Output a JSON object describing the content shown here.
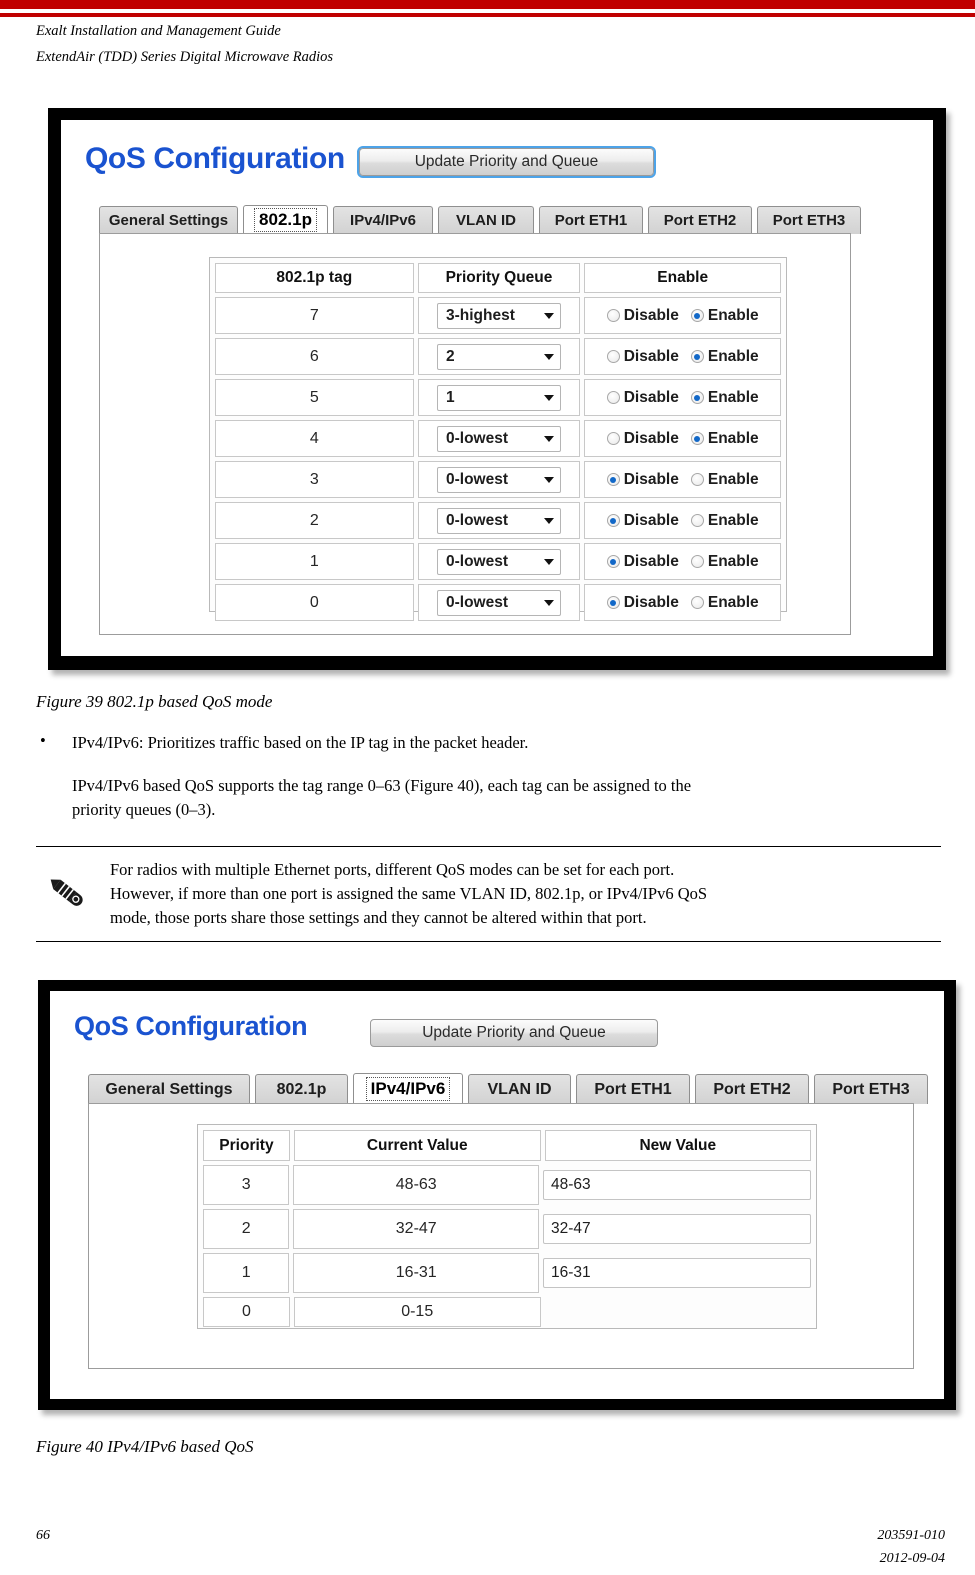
{
  "header": {
    "line1": "Exalt Installation and Management Guide",
    "line2": "ExtendAir (TDD) Series Digital Microwave Radios",
    "rule_color": "#c00000"
  },
  "figure39": {
    "caption": "Figure 39   802.1p based QoS mode",
    "screen": {
      "title": "QoS Configuration",
      "update_button": "Update Priority and Queue",
      "tabs": [
        {
          "label": "General Settings",
          "active": false
        },
        {
          "label": "802.1p",
          "active": true
        },
        {
          "label": "IPv4/IPv6",
          "active": false
        },
        {
          "label": "VLAN ID",
          "active": false
        },
        {
          "label": "Port ETH1",
          "active": false
        },
        {
          "label": "Port ETH2",
          "active": false
        },
        {
          "label": "Port ETH3",
          "active": false
        }
      ],
      "table": {
        "headers": [
          "802.1p tag",
          "Priority Queue",
          "Enable"
        ],
        "radio_labels": {
          "disable": "Disable",
          "enable": "Enable"
        },
        "rows": [
          {
            "tag": "7",
            "queue": "3-highest",
            "state": "enable"
          },
          {
            "tag": "6",
            "queue": "2",
            "state": "enable"
          },
          {
            "tag": "5",
            "queue": "1",
            "state": "enable"
          },
          {
            "tag": "4",
            "queue": "0-lowest",
            "state": "enable"
          },
          {
            "tag": "3",
            "queue": "0-lowest",
            "state": "disable"
          },
          {
            "tag": "2",
            "queue": "0-lowest",
            "state": "disable"
          },
          {
            "tag": "1",
            "queue": "0-lowest",
            "state": "disable"
          },
          {
            "tag": "0",
            "queue": "0-lowest",
            "state": "disable"
          }
        ]
      }
    }
  },
  "body": {
    "bullet_marker": "•",
    "bullet_text": "IPv4/IPv6: Prioritizes traffic based on the IP tag in the packet header.",
    "paragraph_line1": "IPv4/IPv6 based QoS supports the tag range 0–63 (Figure 40), each tag can be assigned to the",
    "paragraph_line2": "priority queues (0–3)."
  },
  "note": {
    "icon": "pencil-icon",
    "line1": "For radios with multiple Ethernet ports, different QoS modes can be set for each port.",
    "line2": "However, if more than one port is assigned the same VLAN ID, 802.1p, or IPv4/IPv6 QoS",
    "line3": "mode, those ports share those settings and they cannot be altered within that port."
  },
  "figure40": {
    "caption": "Figure 40   IPv4/IPv6 based QoS",
    "screen": {
      "title": "QoS Configuration",
      "update_button": "Update Priority and Queue",
      "tabs": [
        {
          "label": "General Settings",
          "active": false
        },
        {
          "label": "802.1p",
          "active": false
        },
        {
          "label": "IPv4/IPv6",
          "active": true
        },
        {
          "label": "VLAN ID",
          "active": false
        },
        {
          "label": "Port ETH1",
          "active": false
        },
        {
          "label": "Port ETH2",
          "active": false
        },
        {
          "label": "Port ETH3",
          "active": false
        }
      ],
      "table": {
        "headers": [
          "Priority",
          "Current Value",
          "New Value"
        ],
        "rows": [
          {
            "priority": "3",
            "current": "48-63",
            "new": "48-63",
            "has_input": true
          },
          {
            "priority": "2",
            "current": "32-47",
            "new": "32-47",
            "has_input": true
          },
          {
            "priority": "1",
            "current": "16-31",
            "new": "16-31",
            "has_input": true
          },
          {
            "priority": "0",
            "current": "0-15",
            "new": "",
            "has_input": false
          }
        ]
      }
    }
  },
  "footer": {
    "page_number": "66",
    "doc_number": "203591-010",
    "date": "2012-09-04"
  }
}
